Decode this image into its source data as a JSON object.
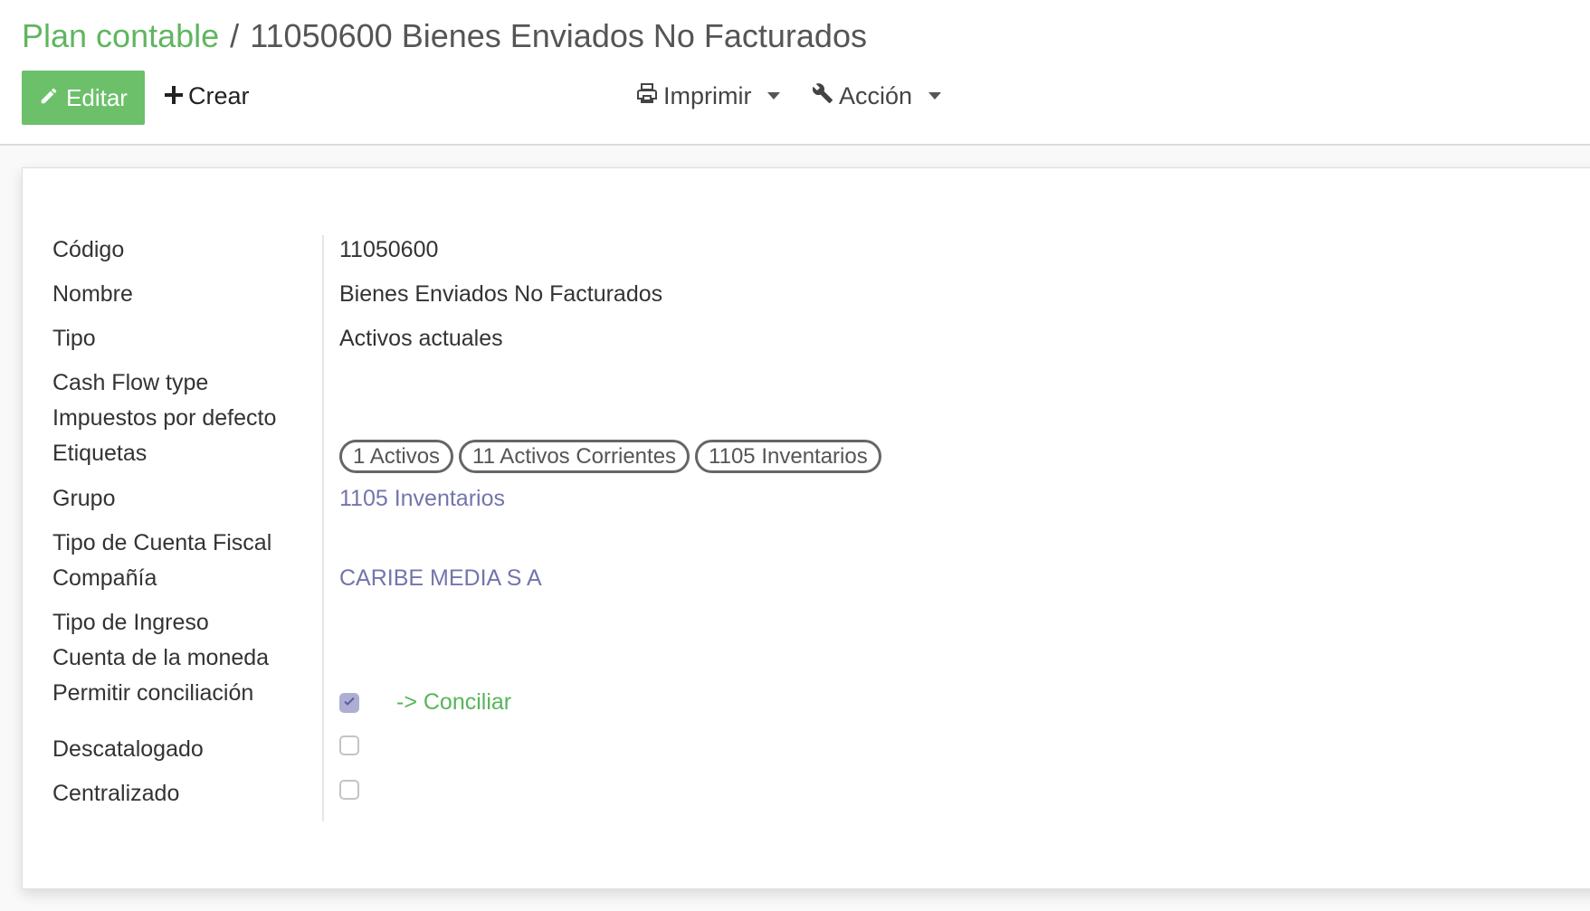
{
  "breadcrumb": {
    "parent": "Plan contable",
    "separator": "/",
    "current": "11050600 Bienes Enviados No Facturados"
  },
  "toolbar": {
    "edit_label": "Editar",
    "create_label": "Crear",
    "print_label": "Imprimir",
    "action_label": "Acción"
  },
  "form": {
    "labels": {
      "code": "Código",
      "name": "Nombre",
      "type": "Tipo",
      "cash_flow_type": "Cash Flow type",
      "default_taxes": "Impuestos por defecto",
      "tags": "Etiquetas",
      "group": "Grupo",
      "fiscal_account_type": "Tipo de Cuenta Fiscal",
      "company": "Compañía",
      "income_type": "Tipo de Ingreso",
      "currency_account": "Cuenta de la moneda",
      "allow_reconcile": "Permitir conciliación",
      "deprecated": "Descatalogado",
      "centralized": "Centralizado"
    },
    "values": {
      "code": "11050600",
      "name": "Bienes Enviados No Facturados",
      "type": "Activos actuales",
      "tags": [
        "1 Activos",
        "11 Activos Corrientes",
        "1105 Inventarios"
      ],
      "group": "1105 Inventarios",
      "company": "CARIBE MEDIA S A",
      "allow_reconcile": true,
      "deprecated": false,
      "centralized": false
    },
    "reconcile_button": "-> Conciliar"
  },
  "colors": {
    "accent_green": "#6cc06a",
    "link_purple": "#7375ab",
    "checkbox_checked": "#aeaed3"
  }
}
